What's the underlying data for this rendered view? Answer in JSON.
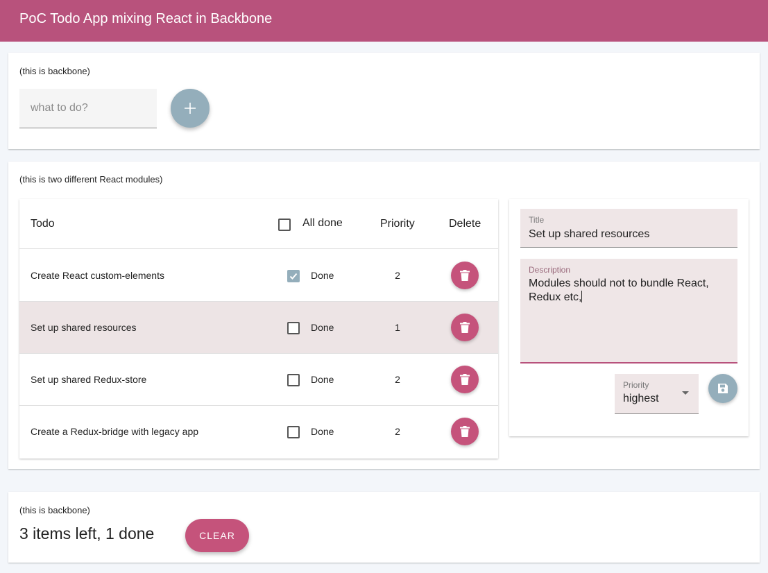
{
  "app": {
    "title": "PoC Todo App mixing React in Backbone",
    "accent_color": "#b8527c"
  },
  "backbone_top": {
    "note": "(this is backbone)",
    "input": {
      "placeholder": "what to do?",
      "value": ""
    },
    "add_button": {
      "icon": "plus-icon"
    }
  },
  "react_section": {
    "note": "(this is two different React modules)",
    "table": {
      "headers": {
        "todo": "Todo",
        "all_done": "All done",
        "priority": "Priority",
        "delete": "Delete"
      },
      "all_done_checked": false,
      "rows": [
        {
          "title": "Create React custom-elements",
          "done": true,
          "done_label": "Done",
          "priority": "2",
          "selected": false
        },
        {
          "title": "Set up shared resources",
          "done": false,
          "done_label": "Done",
          "priority": "1",
          "selected": true
        },
        {
          "title": "Set up shared Redux-store",
          "done": false,
          "done_label": "Done",
          "priority": "2",
          "selected": false
        },
        {
          "title": "Create a Redux-bridge with legacy app",
          "done": false,
          "done_label": "Done",
          "priority": "2",
          "selected": false
        }
      ]
    },
    "editor": {
      "title_label": "Title",
      "title_value": "Set up shared resources",
      "description_label": "Description",
      "description_value": "Modules should not to bundle React, Redux etc,",
      "priority_label": "Priority",
      "priority_value": "highest",
      "save_button": {
        "icon": "save-icon"
      }
    }
  },
  "backbone_bottom": {
    "note": "(this is backbone)",
    "summary": "3 items left, 1 done",
    "clear_label": "CLEAR"
  }
}
